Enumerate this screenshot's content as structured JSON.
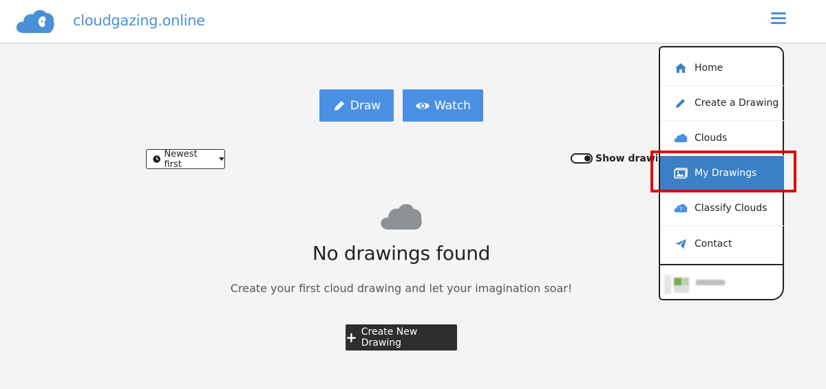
{
  "header": {
    "brand": "cloudgazing.online",
    "menu_icon": "hamburger-menu-icon"
  },
  "actions": {
    "draw_label": "Draw",
    "watch_label": "Watch"
  },
  "filters": {
    "sort_selected": "Newest first",
    "toggle_label": "Show drawings"
  },
  "empty_state": {
    "title": "No drawings found",
    "subtitle": "Create your first cloud drawing and let your imagination soar!",
    "create_label": "Create New Drawing"
  },
  "menu": {
    "items": [
      {
        "label": "Home",
        "icon": "home-icon"
      },
      {
        "label": "Create a Drawing",
        "icon": "pencil-icon"
      },
      {
        "label": "Clouds",
        "icon": "cloud-icon"
      },
      {
        "label": "My Drawings",
        "icon": "images-icon"
      },
      {
        "label": "Classify Clouds",
        "icon": "cloud-question-icon"
      },
      {
        "label": "Contact",
        "icon": "paper-plane-icon"
      }
    ],
    "active_index": 3
  },
  "colors": {
    "accent": "#4a90e2",
    "active_menu": "#3b7fc4",
    "highlight": "#e00000",
    "dark_button": "#2e2e2e"
  }
}
